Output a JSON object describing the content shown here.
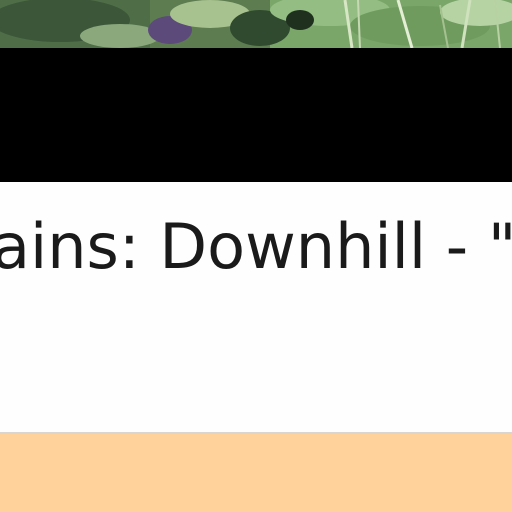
{
  "header": {
    "image": "nature-foliage-photo"
  },
  "title": {
    "text": "ains: Downhill - \"El"
  },
  "colors": {
    "band": "#000000",
    "background": "#fefefe",
    "footer": "#ffd29c",
    "title_text": "#1a1a1a"
  }
}
